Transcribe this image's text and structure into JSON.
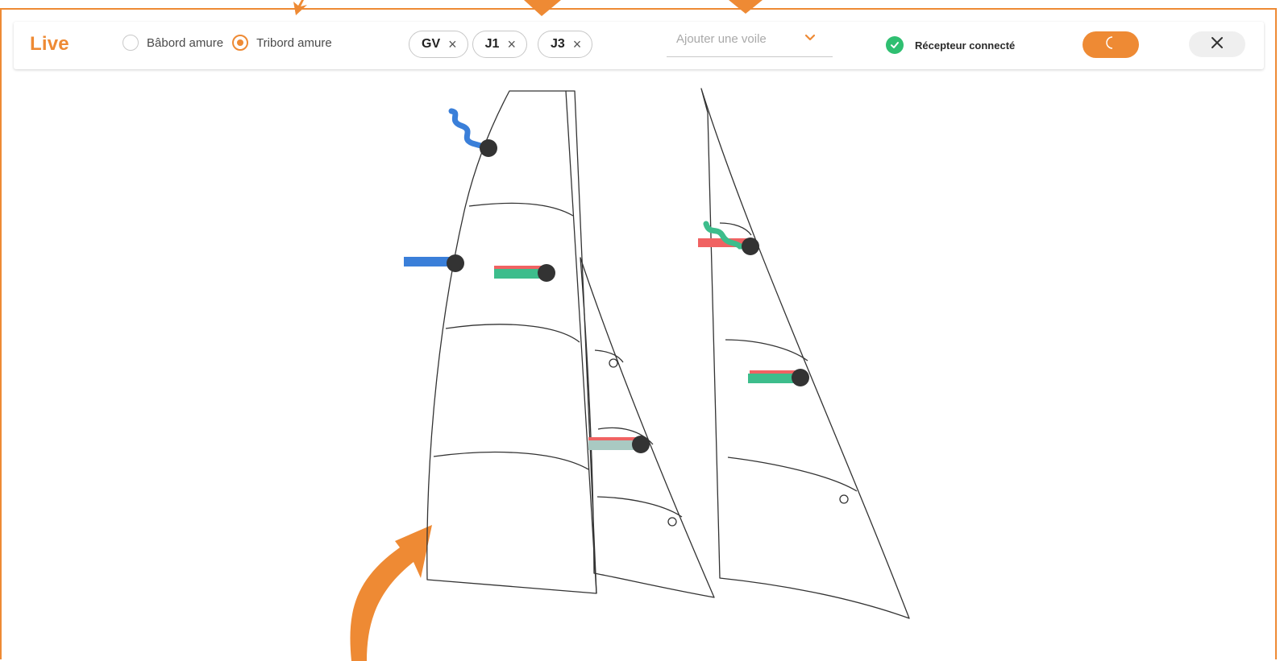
{
  "header": {
    "title": "Live",
    "tack_options": [
      {
        "label": "Bâbord amure",
        "selected": false
      },
      {
        "label": "Tribord amure",
        "selected": true
      }
    ],
    "sail_chips": [
      {
        "label": "GV",
        "remove": "×"
      },
      {
        "label": "J1",
        "remove": "×"
      },
      {
        "label": "J3",
        "remove": "×"
      }
    ],
    "add_sail": {
      "placeholder": "Ajouter une voile",
      "icon": "chevron-down-icon"
    },
    "receiver_status": {
      "label": "Récepteur connecté",
      "state": "connected",
      "icon": "check-circle-icon"
    },
    "night_mode_icon": "moon-icon",
    "close_icon": "close-icon"
  },
  "colors": {
    "accent": "#ee8a34",
    "status_ok": "#2fbf71",
    "telltale_blue": "#3a7fd9",
    "telltale_green": "#3dbd8c",
    "telltale_red": "#f06262",
    "sensor": "#333333"
  },
  "sails": [
    {
      "name": "GV",
      "sensors": 3
    },
    {
      "name": "J1",
      "sensors": 1
    },
    {
      "name": "J3",
      "sensors": 2
    }
  ]
}
